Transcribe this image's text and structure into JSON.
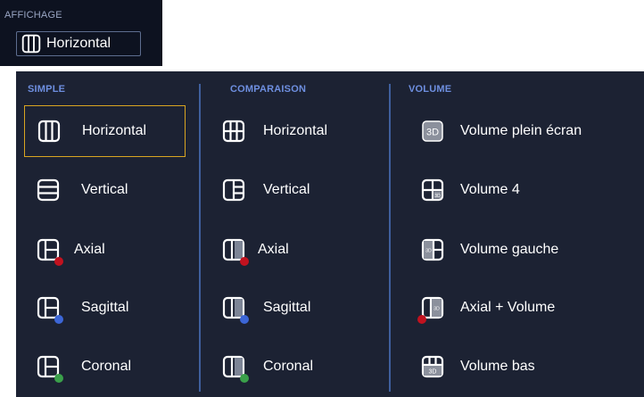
{
  "header": {
    "label": "AFFICHAGE",
    "current_layout": "Horizontal",
    "current_icon": "layout-3-columns-icon"
  },
  "colors": {
    "panel_bg": "#1c2233",
    "section_title": "#6e8fe0",
    "selected_border": "#d9a521",
    "dot_red": "#c1121f",
    "dot_blue": "#3c66d6",
    "dot_green": "#3aa04a"
  },
  "sections": [
    {
      "title": "SIMPLE",
      "items": [
        {
          "label": "Horizontal",
          "icon": "layout-3-columns-icon",
          "selected": true
        },
        {
          "label": "Vertical",
          "icon": "layout-3-rows-icon"
        },
        {
          "label": "Axial",
          "icon": "layout-split-left-icon",
          "dot": "red"
        },
        {
          "label": "Sagittal",
          "icon": "layout-split-left-icon",
          "dot": "blue"
        },
        {
          "label": "Coronal",
          "icon": "layout-split-left-icon",
          "dot": "green"
        }
      ]
    },
    {
      "title": "COMPARAISON",
      "items": [
        {
          "label": "Horizontal",
          "icon": "layout-grid-3x2-icon"
        },
        {
          "label": "Vertical",
          "icon": "layout-grid-2x3-icon"
        },
        {
          "label": "Axial",
          "icon": "layout-compare-2-columns-icon",
          "dot": "red"
        },
        {
          "label": "Sagittal",
          "icon": "layout-compare-2-columns-icon",
          "dot": "blue"
        },
        {
          "label": "Coronal",
          "icon": "layout-compare-2-columns-icon",
          "dot": "green"
        }
      ]
    },
    {
      "title": "VOLUME",
      "items": [
        {
          "label": "Volume plein écran",
          "icon": "volume-3d-fullscreen-icon"
        },
        {
          "label": "Volume 4",
          "icon": "volume-4-grid-icon"
        },
        {
          "label": "Volume gauche",
          "icon": "volume-left-icon"
        },
        {
          "label": "Axial + Volume",
          "icon": "axial-plus-volume-icon",
          "dot": "red"
        },
        {
          "label": "Volume bas",
          "icon": "volume-bottom-icon"
        }
      ]
    }
  ]
}
